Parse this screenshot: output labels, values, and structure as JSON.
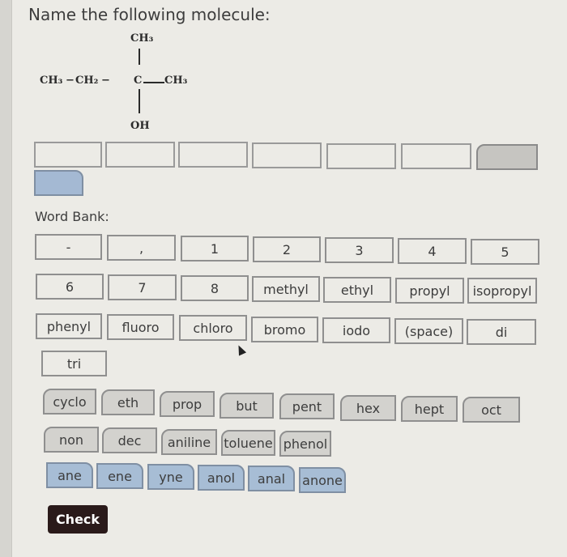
{
  "question": {
    "title": "Name the following molecule:"
  },
  "molecule": {
    "top": "CH₃",
    "chain_left1": "CH₃",
    "bond1": "−",
    "chain_left2": "CH₂",
    "bond2": "−",
    "center": "C",
    "right": "CH₃",
    "bottom": "OH"
  },
  "answer_slots": {
    "count_empty": 6,
    "slots": [
      "",
      "",
      "",
      "",
      "",
      "",
      "",
      ""
    ]
  },
  "word_bank": {
    "label": "Word Bank:",
    "row1": [
      "-",
      ",",
      "1",
      "2",
      "3",
      "4",
      "5"
    ],
    "row2": [
      "6",
      "7",
      "8",
      "methyl",
      "ethyl",
      "propyl",
      "isopropyl"
    ],
    "row3": [
      "phenyl",
      "fluoro",
      "chloro",
      "bromo",
      "iodo",
      "(space)",
      "di"
    ],
    "row4": [
      "tri"
    ],
    "roots1": [
      "cyclo",
      "eth",
      "prop",
      "but",
      "pent",
      "hex",
      "hept",
      "oct"
    ],
    "roots2": [
      "non",
      "dec",
      "aniline",
      "toluene",
      "phenol"
    ],
    "suffixes": [
      "ane",
      "ene",
      "yne",
      "anol",
      "anal",
      "anone"
    ]
  },
  "actions": {
    "check_label": "Check"
  },
  "colors": {
    "prefix_tile": "#ecebe6",
    "root_tile": "#d3d2ce",
    "suffix_tile": "#a7bdd5",
    "check_button": "#2a1a1a"
  }
}
